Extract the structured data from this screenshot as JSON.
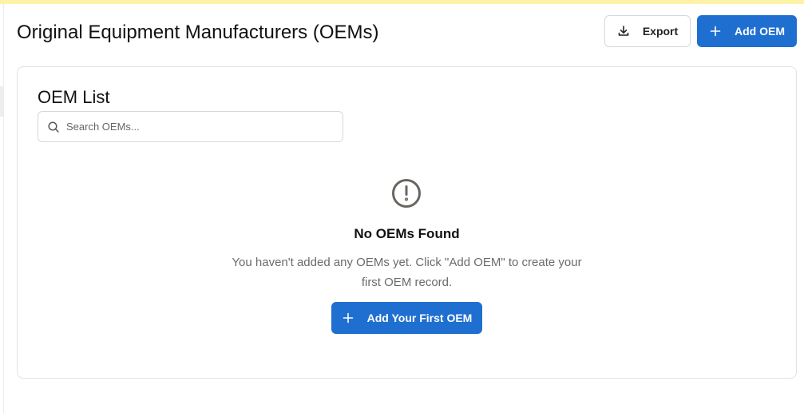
{
  "page": {
    "title": "Original Equipment Manufacturers (OEMs)"
  },
  "header": {
    "export_label": "Export",
    "add_label": "Add OEM"
  },
  "card": {
    "title": "OEM List",
    "search": {
      "placeholder": "Search OEMs...",
      "value": ""
    }
  },
  "empty_state": {
    "icon": "alert-circle-icon",
    "title": "No OEMs Found",
    "description": "You haven't added any OEMs yet. Click \"Add OEM\" to create your first OEM record.",
    "button_label": "Add Your First OEM"
  },
  "colors": {
    "primary": "#1f6fd1",
    "top_accent": "#fdf2a8",
    "muted_text": "#6b6b6b",
    "icon_gray": "#6b6560"
  },
  "icons": {
    "export": "download-icon",
    "add": "plus-icon",
    "search": "search-icon"
  }
}
